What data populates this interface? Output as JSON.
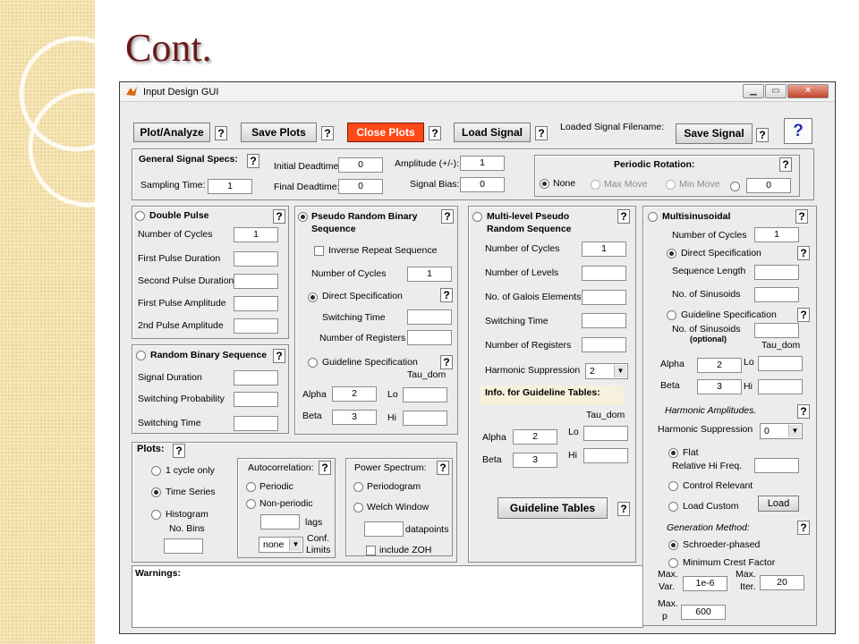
{
  "slide_title": "Cont.",
  "window": {
    "title": "Input Design GUI"
  },
  "toolbar": {
    "plot_analyze": "Plot/Analyze",
    "save_plots": "Save Plots",
    "close_plots": "Close Plots",
    "load_signal": "Load Signal",
    "loaded_filename_label": "Loaded Signal Filename:",
    "save_signal": "Save Signal"
  },
  "help": "?",
  "general": {
    "title": "General Signal Specs:",
    "sampling_time_label": "Sampling Time:",
    "sampling_time": "1",
    "initial_deadtime_label": "Initial Deadtime:",
    "initial_deadtime": "0",
    "final_deadtime_label": "Final Deadtime:",
    "final_deadtime": "0",
    "amplitude_label": "Amplitude (+/-):",
    "amplitude": "1",
    "bias_label": "Signal Bias:",
    "bias": "0"
  },
  "periodic": {
    "title": "Periodic Rotation:",
    "none": "None",
    "max_move": "Max Move",
    "min_move": "Min Move",
    "value": "0"
  },
  "double_pulse": {
    "title": "Double Pulse",
    "cycles_label": "Number of Cycles",
    "cycles": "1",
    "first_dur": "First Pulse Duration",
    "second_dur": "Second Pulse Duration",
    "first_amp": "First Pulse Amplitude",
    "second_amp": "2nd Pulse Amplitude"
  },
  "rbs": {
    "title": "Random Binary Sequence",
    "duration": "Signal Duration",
    "prob": "Switching Probability",
    "time": "Switching Time"
  },
  "prbs": {
    "title1": "Pseudo Random Binary",
    "title2": "Sequence",
    "inverse": "Inverse Repeat Sequence",
    "cycles_label": "Number of Cycles",
    "cycles": "1",
    "direct": "Direct Specification",
    "switching": "Switching Time",
    "registers": "Number of Registers",
    "guideline": "Guideline Specification",
    "tau": "Tau_dom",
    "alpha_label": "Alpha",
    "alpha": "2",
    "beta_label": "Beta",
    "beta": "3",
    "lo": "Lo",
    "hi": "Hi"
  },
  "mlps": {
    "title1": "Multi-level Pseudo",
    "title2": "Random Sequence",
    "cycles_label": "Number of Cycles",
    "cycles": "1",
    "levels": "Number of Levels",
    "galois": "No. of Galois Elements",
    "switching": "Switching Time",
    "registers": "Number of Registers",
    "harmonic_label": "Harmonic Suppression",
    "harmonic": "2",
    "info": "Info. for Guideline Tables:",
    "tau": "Tau_dom",
    "alpha_label": "Alpha",
    "alpha": "2",
    "beta_label": "Beta",
    "beta": "3",
    "lo": "Lo",
    "hi": "Hi",
    "tables_btn": "Guideline Tables"
  },
  "multisine": {
    "title": "Multisinusoidal",
    "cycles_label": "Number of Cycles",
    "cycles": "1",
    "direct": "Direct Specification",
    "seq_len": "Sequence Length",
    "num_sin": "No. of Sinusoids",
    "guideline": "Guideline Specification",
    "num_sin2": "No. of Sinusoids",
    "optional": "(optional)",
    "tau": "Tau_dom",
    "alpha_label": "Alpha",
    "alpha": "2",
    "beta_label": "Beta",
    "beta": "3",
    "lo": "Lo",
    "hi": "Hi",
    "harm_amp": "Harmonic Amplitudes.",
    "harm_supp_label": "Harmonic Suppression",
    "harm_supp": "0",
    "flat": "Flat",
    "rel_hi": "Relative Hi Freq.",
    "control": "Control Relevant",
    "load_custom": "Load Custom",
    "load_btn": "Load",
    "gen_method": "Generation Method:",
    "schroeder": "Schroeder-phased",
    "min_crest": "Minimum Crest Factor",
    "max_var_label1": "Max.",
    "max_var_label2": "Var.",
    "max_var": "1e-6",
    "max_iter_label1": "Max.",
    "max_iter_label2": "Iter.",
    "max_iter": "20",
    "max_p_label1": "Max.",
    "max_p_label2": "p",
    "max_p": "600"
  },
  "plots": {
    "title": "Plots:",
    "one_cycle": "1 cycle only",
    "time_series": "Time Series",
    "histogram": "Histogram",
    "bins": "No. Bins"
  },
  "autocorr": {
    "title": "Autocorrelation:",
    "periodic": "Periodic",
    "nonperiodic": "Non-periodic",
    "lags": "lags",
    "conf_value": "none",
    "conf1": "Conf.",
    "conf2": "Limits"
  },
  "power": {
    "title": "Power Spectrum:",
    "periodogram": "Periodogram",
    "welch": "Welch Window",
    "datapoints": "datapoints",
    "zoh": "include ZOH"
  },
  "warnings": {
    "label": "Warnings:"
  }
}
